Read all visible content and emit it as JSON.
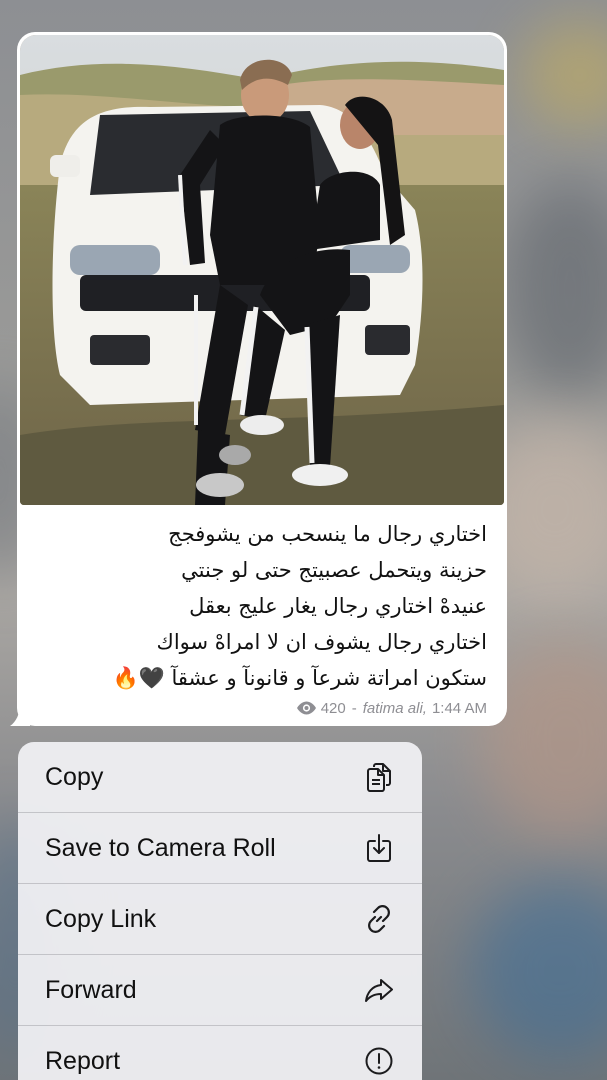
{
  "message": {
    "caption": "اختاري رجال ما ينسحب من يشوفجج\nحزينة ويتحمل عصبيتج حتى لو جنتي\nعنيدهْ اختاري رجال يغار عليج بعقل\nاختاري رجال يشوف ان لا امراهْ سواك\nستكون امراتة شرعآ و قانونآ و عشقآ 🖤🔥",
    "views": "420",
    "separator": "-",
    "author": "fatima ali,",
    "time": "1:44 AM"
  },
  "menu": {
    "items": [
      {
        "label": "Copy",
        "icon": "copy-icon"
      },
      {
        "label": "Save to Camera Roll",
        "icon": "download-icon"
      },
      {
        "label": "Copy Link",
        "icon": "link-icon"
      },
      {
        "label": "Forward",
        "icon": "forward-arrow-icon"
      },
      {
        "label": "Report",
        "icon": "exclamation-circle-icon"
      }
    ]
  },
  "colors": {
    "bubble": "#ffffff",
    "menu_background": "#f2f2f5",
    "meta_text": "#8e8e93"
  }
}
